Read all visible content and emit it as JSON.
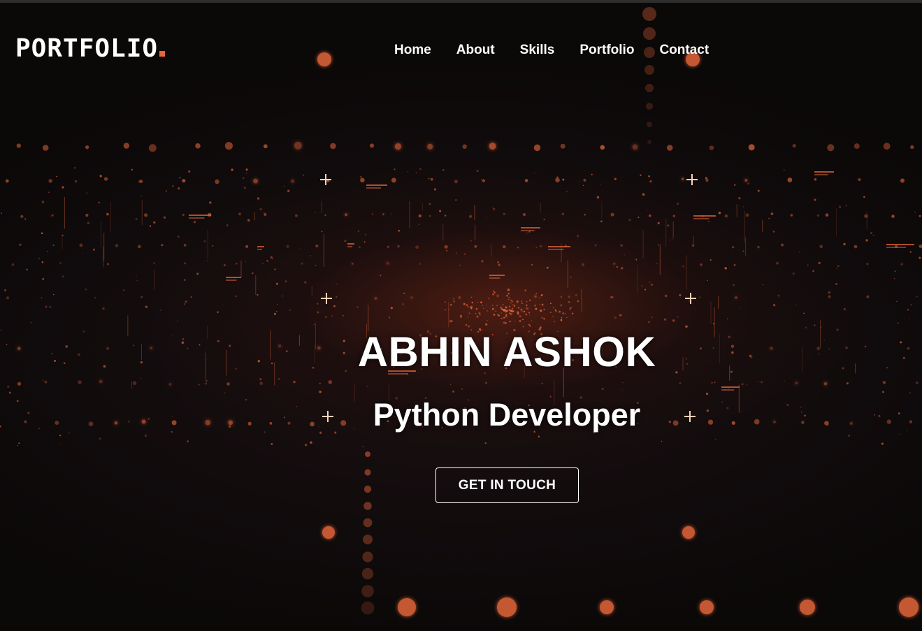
{
  "brand": {
    "logo_text": "PORTFOLIO",
    "accent_color": "#e5663a"
  },
  "nav": {
    "items": [
      {
        "label": "Home"
      },
      {
        "label": "About"
      },
      {
        "label": "Skills"
      },
      {
        "label": "Portfolio"
      },
      {
        "label": "Contact"
      }
    ]
  },
  "hero": {
    "name": "ABHIN ASHOK",
    "role": "Python Developer",
    "cta_label": "GET IN TOUCH",
    "background_theme": "dark digital particle grid with orange glowing dots"
  },
  "colors": {
    "background": "#0e0a0a",
    "text": "#ffffff",
    "particle": "#e5663a"
  }
}
